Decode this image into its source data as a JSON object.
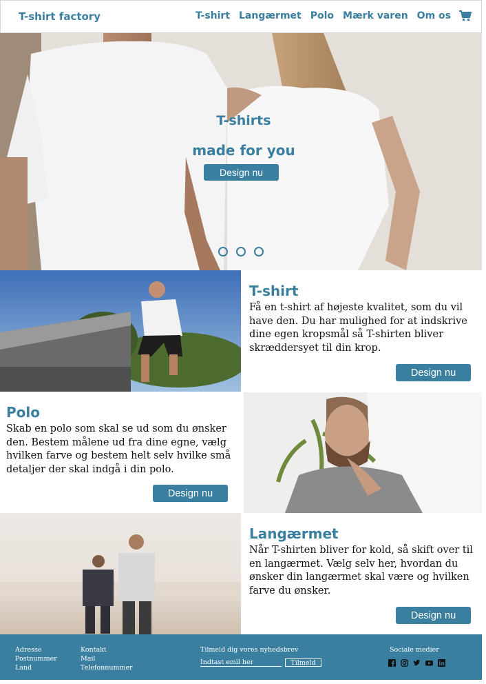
{
  "header": {
    "brand": "T-shirt factory",
    "nav": [
      "T-shirt",
      "Langærmet",
      "Polo",
      "Mærk varen",
      "Om os"
    ],
    "cart_icon": "shopping-cart-icon"
  },
  "hero": {
    "title_line1": "T-shirts",
    "title_line2": "made for you",
    "button": "Design nu",
    "slides": 3
  },
  "sections": {
    "tshirt": {
      "title": "T-shirt",
      "text": "Få en t-shirt af højeste kvalitet, som du vil have den. Du har mulighed for at indskrive dine egen kropsmål så T-shirten bliver skræddersyet til din krop.",
      "button": "Design nu"
    },
    "polo": {
      "title": "Polo",
      "text": "Skab en polo som skal se ud som du ønsker den. Bestem målene ud fra dine egne, vælg hvilken farve og bestem helt selv hvilke små detaljer der skal indgå i din polo.",
      "button": "Design nu"
    },
    "longsleeve": {
      "title": "Langærmet",
      "text": "Når T-shirten bliver for kold, så skift over til en langærmet. Vælg selv her, hvordan du ønsker din langærmet skal være og hvilken farve du ønsker.",
      "button": "Design nu"
    }
  },
  "footer": {
    "address": [
      "Adresse",
      "Postnummer",
      "Land"
    ],
    "contact": [
      "Kontakt",
      "Mail",
      "Telefonnummer"
    ],
    "newsletter_label": "Tilmeld dig vores nyhedsbrev",
    "newsletter_placeholder": "Indtast emil her",
    "newsletter_button": "Tilmeld",
    "social_label": "Sociale medier",
    "social_icons": [
      "facebook-icon",
      "instagram-icon",
      "twitter-icon",
      "youtube-icon",
      "linkedin-icon"
    ]
  },
  "colors": {
    "accent": "#3a7fa0",
    "footer_bg": "#3a7fa0"
  }
}
